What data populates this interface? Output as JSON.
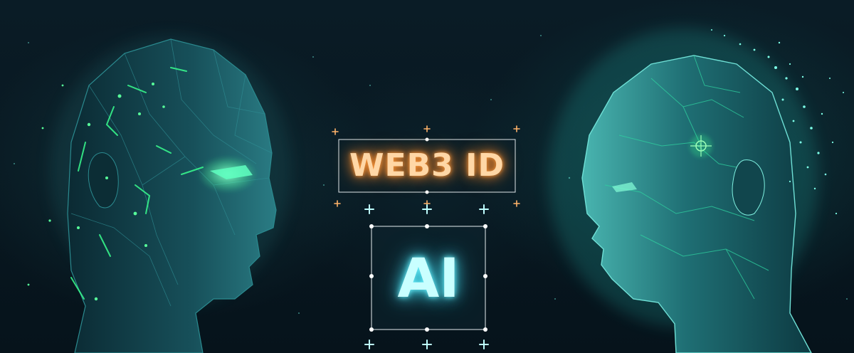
{
  "badges": {
    "web3": "WEB3 ID",
    "ai": "AI"
  },
  "colors": {
    "background": "#071620",
    "accent_orange": "#ff9a3c",
    "accent_cyan": "#6ef4ff",
    "circuit_green": "#39ff8f",
    "head_teal": "#1f6f74"
  },
  "icons": [
    "plus-icon",
    "selection-handle-icon"
  ]
}
